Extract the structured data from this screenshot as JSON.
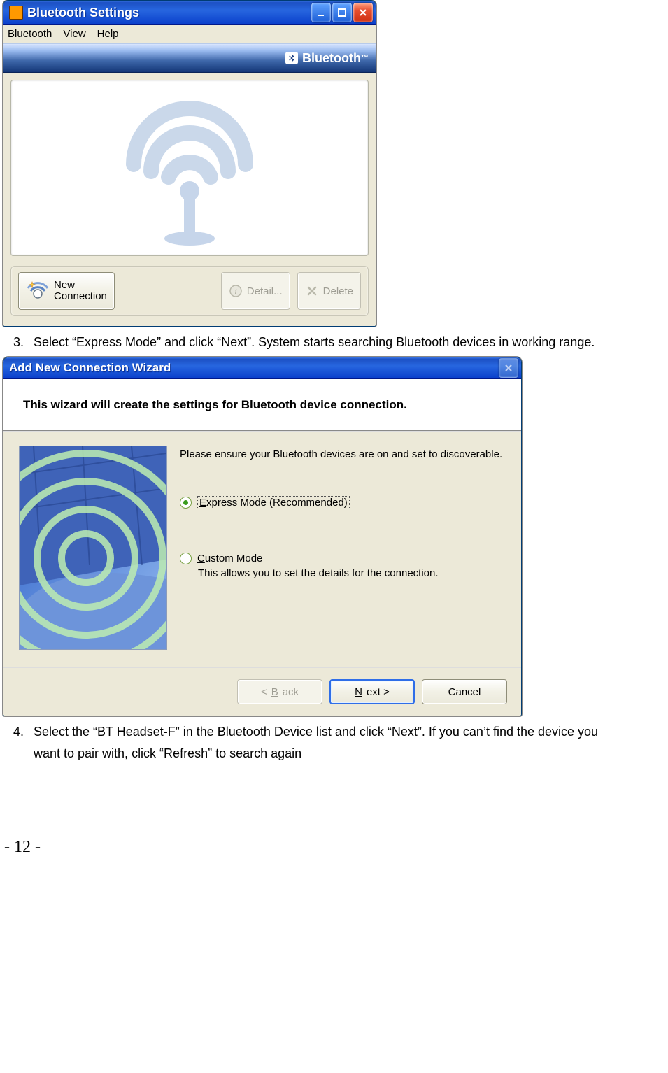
{
  "window1": {
    "title": "Bluetooth Settings",
    "menus": {
      "bluetooth": "Bluetooth",
      "view": "View",
      "help": "Help"
    },
    "brand": "Bluetooth",
    "buttons": {
      "newconn_line1": "New",
      "newconn_line2": "Connection",
      "detail": "Detail...",
      "delete": "Delete"
    }
  },
  "step3": {
    "num": "3.",
    "text": "Select “Express Mode” and click “Next”. System starts searching Bluetooth devices in working range."
  },
  "wizard": {
    "title": "Add New Connection Wizard",
    "heading": "This wizard will create the settings for Bluetooth device connection.",
    "ensure": "Please ensure your Bluetooth devices are on and set to discoverable.",
    "express_label": "Express Mode (Recommended)",
    "custom_label": "Custom Mode",
    "custom_desc": "This allows you to set the details for the connection.",
    "back": "< Back",
    "next": "Next >",
    "cancel": "Cancel"
  },
  "step4": {
    "num": "4.",
    "text1": "Select the “BT Headset-F” in the Bluetooth Device list and click “Next”. If you can’t find the device you",
    "text2": "want to pair with, click “Refresh” to search again"
  },
  "page_number": "- 12 -"
}
